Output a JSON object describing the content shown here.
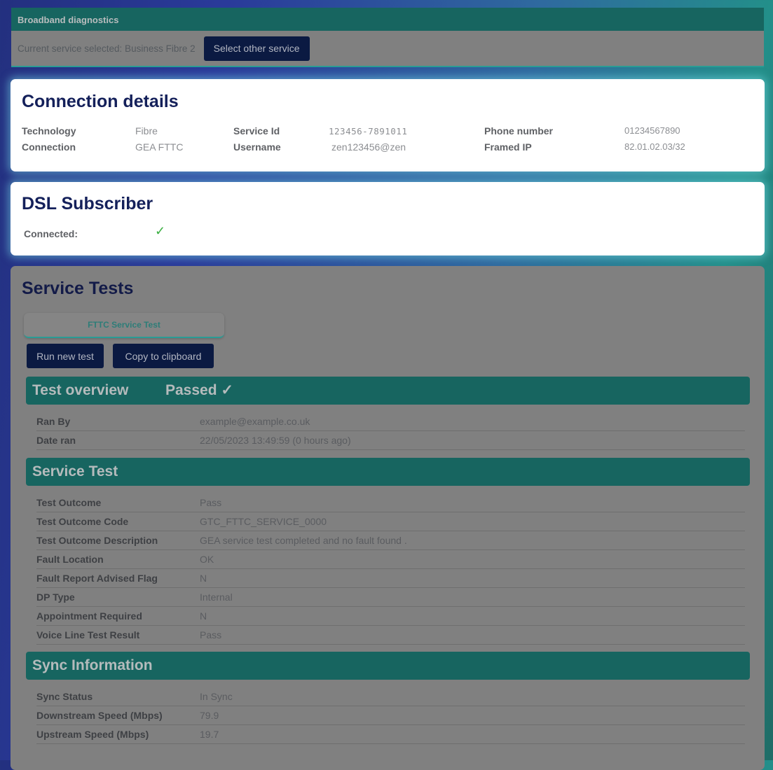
{
  "diagnostics": {
    "title": "Broadband diagnostics",
    "current_service_text": "Current service selected: Business Fibre 2",
    "select_other_label": "Select other service"
  },
  "connection_details": {
    "title": "Connection details",
    "fields": [
      {
        "label": "Technology",
        "value": "Fibre"
      },
      {
        "label": "Connection",
        "value": "GEA FTTC"
      },
      {
        "label": "Service Id",
        "value": "123456-7891011"
      },
      {
        "label": "Username",
        "value": "zen123456@zen"
      },
      {
        "label": "Phone number",
        "value": "01234567890"
      },
      {
        "label": "Framed IP",
        "value": "82.01.02.03/32"
      }
    ]
  },
  "dsl_subscriber": {
    "title": "DSL Subscriber",
    "connected_label": "Connected:",
    "connected_icon": "check-icon",
    "connected_value": "✓",
    "status_color": "#3cb043"
  },
  "service_tests": {
    "title": "Service Tests",
    "tab_label": "FTTC Service Test",
    "run_new_test_label": "Run new test",
    "copy_label": "Copy to clipboard",
    "overview": {
      "title": "Test overview",
      "status": "Passed ✓",
      "rows": [
        {
          "label": "Ran By",
          "value": "example@example.co.uk"
        },
        {
          "label": "Date ran",
          "value": "22/05/2023 13:49:59 (0 hours ago)"
        }
      ]
    },
    "service_test": {
      "title": "Service Test",
      "rows": [
        {
          "label": "Test Outcome",
          "value": "Pass"
        },
        {
          "label": "Test Outcome Code",
          "value": "GTC_FTTC_SERVICE_0000"
        },
        {
          "label": "Test Outcome Description",
          "value": "GEA service test completed and no fault found ."
        },
        {
          "label": "Fault Location",
          "value": "OK"
        },
        {
          "label": "Fault Report Advised Flag",
          "value": "N"
        },
        {
          "label": "DP Type",
          "value": "Internal"
        },
        {
          "label": "Appointment Required",
          "value": "N"
        },
        {
          "label": "Voice Line Test Result",
          "value": "Pass"
        }
      ]
    },
    "sync_information": {
      "title": "Sync Information",
      "rows": [
        {
          "label": "Sync Status",
          "value": "In Sync"
        },
        {
          "label": "Downstream Speed (Mbps)",
          "value": "79.9"
        },
        {
          "label": "Upstream Speed (Mbps)",
          "value": "19.7"
        }
      ]
    }
  },
  "colors": {
    "teal_header": "#176560",
    "navy_button": "#0b1a42",
    "heading_navy": "#14205a"
  }
}
